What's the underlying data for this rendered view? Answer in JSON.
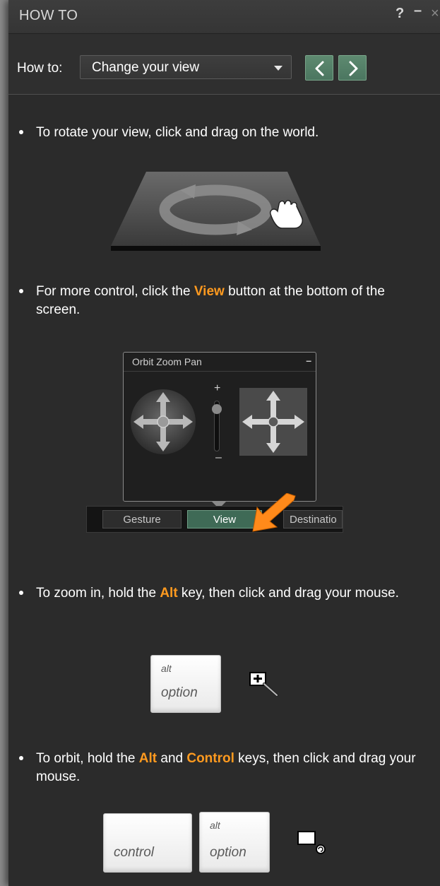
{
  "window": {
    "title": "HOW TO",
    "help_glyph": "?",
    "minimize_glyph": "–",
    "close_glyph": "×"
  },
  "howto": {
    "label": "How to:",
    "selected": "Change your view"
  },
  "steps": [
    {
      "text": "To rotate your view, click and drag on the world."
    },
    {
      "text_before": "For more control, click the ",
      "highlight": "View",
      "text_after": " button at the bottom of the screen."
    },
    {
      "text_before": "To zoom in, hold the ",
      "highlight": "Alt",
      "text_after": " key, then click and drag your mouse."
    },
    {
      "text_before": "To orbit, hold the ",
      "highlight": "Alt",
      "text_middle": " and ",
      "highlight2": "Control",
      "text_after": " keys, then click and drag your mouse."
    }
  ],
  "view_illustration": {
    "panel_title": "Orbit Zoom Pan",
    "panel_min": "–",
    "plus": "+",
    "minus": "–",
    "tabs": [
      "Gesture",
      "View",
      "Destinatio"
    ]
  },
  "keys": {
    "alt_top": "alt",
    "alt_bottom": "option",
    "control": "control"
  },
  "colors": {
    "highlight": "#ff9a1f",
    "nav_button": "#4b7660",
    "panel_bg": "#2b2b2b"
  }
}
